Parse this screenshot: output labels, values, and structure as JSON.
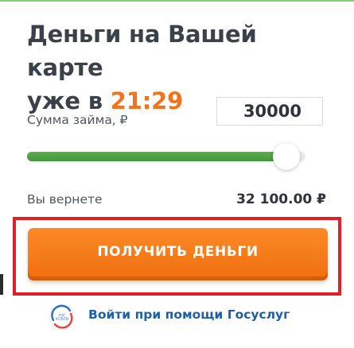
{
  "headline": {
    "line1": "Деньги на Вашей карте",
    "line2_prefix": "уже в ",
    "time": "21:29"
  },
  "loan": {
    "amount_label": "Сумма займа, ₽",
    "amount_value": "30000",
    "slider_fraction": 0.93,
    "return_label": "Вы вернете",
    "return_value": "32 100.00 ₽"
  },
  "cta": {
    "label": "ПОЛУЧИТЬ ДЕНЬГИ"
  },
  "gosuslugi": {
    "icon": "gosuslugi-logo-icon",
    "link_label": "Войти при помощи Госуслуг"
  },
  "colors": {
    "accent": "#f2731d",
    "slider_fill": "#4fa342",
    "highlight": "#e31e24",
    "link": "#1f5fa6"
  }
}
